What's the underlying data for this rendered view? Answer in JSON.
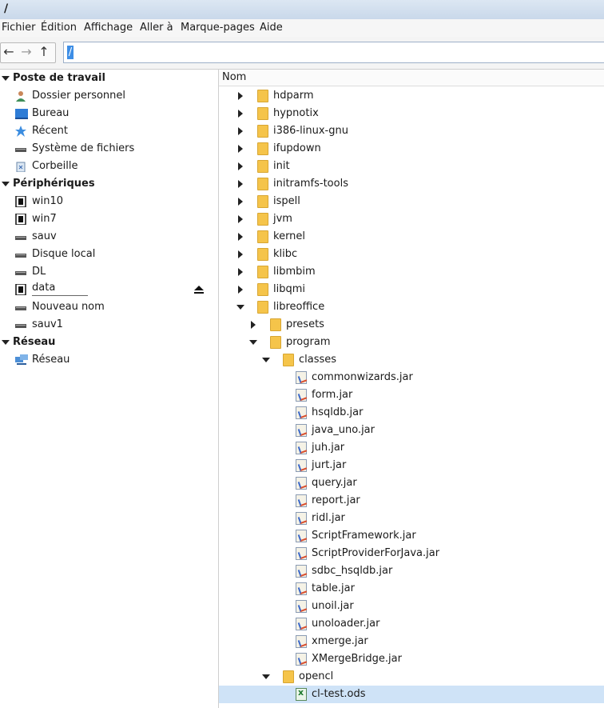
{
  "window": {
    "title": "/"
  },
  "menu": [
    "Fichier",
    "Édition",
    "Affichage",
    "Aller à",
    "Marque-pages",
    "Aide"
  ],
  "toolbar": {
    "back_icon": "arrow-left-icon",
    "forward_icon": "arrow-right-icon",
    "up_icon": "arrow-up-icon",
    "address_value": "/"
  },
  "sidebar": {
    "sections": [
      {
        "title": "Poste de travail",
        "items": [
          {
            "label": "Dossier personnel",
            "icon": "user-icon"
          },
          {
            "label": "Bureau",
            "icon": "desktop-icon"
          },
          {
            "label": "Récent",
            "icon": "star-icon"
          },
          {
            "label": "Système de fichiers",
            "icon": "drive-icon"
          },
          {
            "label": "Corbeille",
            "icon": "trash-icon"
          }
        ]
      },
      {
        "title": "Périphériques",
        "items": [
          {
            "label": "win10",
            "icon": "chip-icon"
          },
          {
            "label": "win7",
            "icon": "chip-icon"
          },
          {
            "label": "sauv",
            "icon": "drive-icon"
          },
          {
            "label": "Disque local",
            "icon": "drive-icon"
          },
          {
            "label": "DL",
            "icon": "drive-icon"
          },
          {
            "label": "data",
            "icon": "chip-icon",
            "eject": true
          },
          {
            "label": "Nouveau nom",
            "icon": "drive-icon"
          },
          {
            "label": "sauv1",
            "icon": "drive-icon"
          }
        ]
      },
      {
        "title": "Réseau",
        "items": [
          {
            "label": "Réseau",
            "icon": "network-icon"
          }
        ]
      }
    ],
    "eject_icon": "eject-icon"
  },
  "files": {
    "column_header": "Nom",
    "rows": [
      {
        "name": "hdparm",
        "type": "folder",
        "depth": 0,
        "expander": "collapsed"
      },
      {
        "name": "hypnotix",
        "type": "folder",
        "depth": 0,
        "expander": "collapsed"
      },
      {
        "name": "i386-linux-gnu",
        "type": "folder",
        "depth": 0,
        "expander": "collapsed"
      },
      {
        "name": "ifupdown",
        "type": "folder",
        "depth": 0,
        "expander": "collapsed"
      },
      {
        "name": "init",
        "type": "folder",
        "depth": 0,
        "expander": "collapsed"
      },
      {
        "name": "initramfs-tools",
        "type": "folder",
        "depth": 0,
        "expander": "collapsed"
      },
      {
        "name": "ispell",
        "type": "folder",
        "depth": 0,
        "expander": "collapsed"
      },
      {
        "name": "jvm",
        "type": "folder",
        "depth": 0,
        "expander": "collapsed"
      },
      {
        "name": "kernel",
        "type": "folder",
        "depth": 0,
        "expander": "collapsed"
      },
      {
        "name": "klibc",
        "type": "folder",
        "depth": 0,
        "expander": "collapsed"
      },
      {
        "name": "libmbim",
        "type": "folder",
        "depth": 0,
        "expander": "collapsed"
      },
      {
        "name": "libqmi",
        "type": "folder",
        "depth": 0,
        "expander": "collapsed"
      },
      {
        "name": "libreoffice",
        "type": "folder",
        "depth": 0,
        "expander": "expanded"
      },
      {
        "name": "presets",
        "type": "folder",
        "depth": 1,
        "expander": "collapsed"
      },
      {
        "name": "program",
        "type": "folder",
        "depth": 1,
        "expander": "expanded"
      },
      {
        "name": "classes",
        "type": "folder",
        "depth": 2,
        "expander": "expanded"
      },
      {
        "name": "commonwizards.jar",
        "type": "jar",
        "depth": 3,
        "expander": "none"
      },
      {
        "name": "form.jar",
        "type": "jar",
        "depth": 3,
        "expander": "none"
      },
      {
        "name": "hsqldb.jar",
        "type": "jar",
        "depth": 3,
        "expander": "none"
      },
      {
        "name": "java_uno.jar",
        "type": "jar",
        "depth": 3,
        "expander": "none"
      },
      {
        "name": "juh.jar",
        "type": "jar",
        "depth": 3,
        "expander": "none"
      },
      {
        "name": "jurt.jar",
        "type": "jar",
        "depth": 3,
        "expander": "none"
      },
      {
        "name": "query.jar",
        "type": "jar",
        "depth": 3,
        "expander": "none"
      },
      {
        "name": "report.jar",
        "type": "jar",
        "depth": 3,
        "expander": "none"
      },
      {
        "name": "ridl.jar",
        "type": "jar",
        "depth": 3,
        "expander": "none"
      },
      {
        "name": "ScriptFramework.jar",
        "type": "jar",
        "depth": 3,
        "expander": "none"
      },
      {
        "name": "ScriptProviderForJava.jar",
        "type": "jar",
        "depth": 3,
        "expander": "none"
      },
      {
        "name": "sdbc_hsqldb.jar",
        "type": "jar",
        "depth": 3,
        "expander": "none"
      },
      {
        "name": "table.jar",
        "type": "jar",
        "depth": 3,
        "expander": "none"
      },
      {
        "name": "unoil.jar",
        "type": "jar",
        "depth": 3,
        "expander": "none"
      },
      {
        "name": "unoloader.jar",
        "type": "jar",
        "depth": 3,
        "expander": "none"
      },
      {
        "name": "xmerge.jar",
        "type": "jar",
        "depth": 3,
        "expander": "none"
      },
      {
        "name": "XMergeBridge.jar",
        "type": "jar",
        "depth": 3,
        "expander": "none"
      },
      {
        "name": "opencl",
        "type": "folder",
        "depth": 2,
        "expander": "expanded"
      },
      {
        "name": "cl-test.ods",
        "type": "ods",
        "depth": 3,
        "expander": "none",
        "selected": true
      }
    ]
  },
  "colors": {
    "selection": "#cfe3f7",
    "folder": "#f5c44a",
    "accent": "#3d8ee6"
  }
}
